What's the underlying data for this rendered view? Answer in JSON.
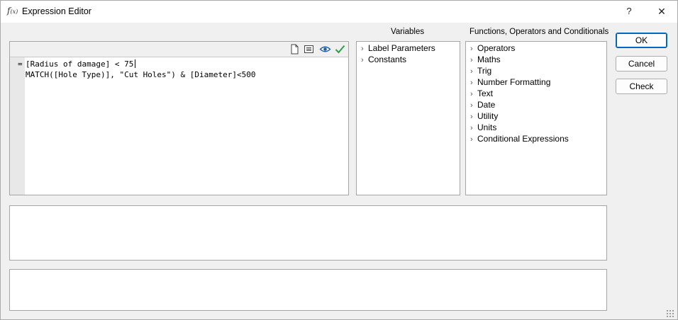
{
  "window": {
    "title": "Expression Editor",
    "icon_text": "f",
    "icon_sub": "(x)",
    "help_glyph": "?",
    "close_glyph": "✕"
  },
  "editor": {
    "prefix": "=",
    "lines": [
      "[Radius of damage] < 75",
      "MATCH([Hole Type)], \"Cut Holes\") & [Diameter]<500"
    ],
    "toolbar_icons": [
      "new-document-icon",
      "list-icon",
      "eye-icon",
      "checkmark-icon"
    ],
    "check_color": "#2e9e47",
    "eye_color": "#1f5fa8"
  },
  "variables": {
    "header": "Variables",
    "items": [
      {
        "label": "Label Parameters"
      },
      {
        "label": "Constants"
      }
    ]
  },
  "functions": {
    "header": "Functions, Operators and Conditionals",
    "items": [
      {
        "label": "Operators"
      },
      {
        "label": "Maths"
      },
      {
        "label": "Trig"
      },
      {
        "label": "Number Formatting"
      },
      {
        "label": "Text"
      },
      {
        "label": "Date"
      },
      {
        "label": "Utility"
      },
      {
        "label": "Units"
      },
      {
        "label": "Conditional Expressions"
      }
    ]
  },
  "buttons": {
    "ok": "OK",
    "cancel": "Cancel",
    "check": "Check"
  },
  "tree_chevron": "›",
  "accent_color": "#0067c0"
}
